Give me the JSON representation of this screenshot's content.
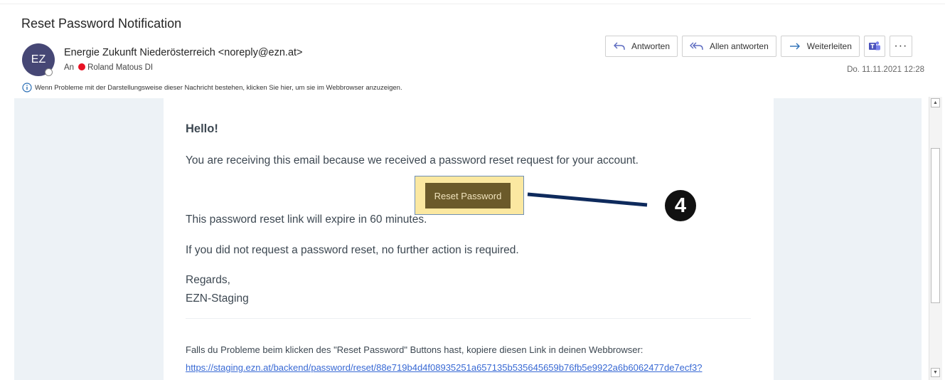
{
  "header": {
    "subject": "Reset Password Notification",
    "avatar_initials": "EZ",
    "from": "Energie Zukunft Niederösterreich <noreply@ezn.at>",
    "to_label": "An",
    "to_name": "Roland Matous DI",
    "date": "Do. 11.11.2021 12:28",
    "info_text": "Wenn Probleme mit der Darstellungsweise dieser Nachricht bestehen, klicken Sie hier, um sie im Webbrowser anzuzeigen."
  },
  "toolbar": {
    "reply": "Antworten",
    "reply_all": "Allen antworten",
    "forward": "Weiterleiten",
    "more": "···",
    "icons": [
      "reply-icon",
      "reply-all-icon",
      "forward-icon",
      "teams-icon",
      "more-icon"
    ]
  },
  "message": {
    "greeting": "Hello!",
    "line1": "You are receiving this email because we received a password reset request for your account.",
    "button": "Reset Password",
    "line2": "This password reset link will expire in 60 minutes.",
    "line3": "If you did not request a password reset, no further action is required.",
    "regards": "Regards,",
    "signature": "EZN-Staging",
    "subcopy": "Falls du Probleme beim klicken des \"Reset Password\" Buttons hast, kopiere diesen Link in deinen Webbrowser:",
    "link": "https://staging.ezn.at/backend/password/reset/88e719b4d4f08935251a657135b535645659b76fb5e9922a6b6062477de7ecf3?"
  },
  "annotation": {
    "badge": "4"
  },
  "colors": {
    "avatar": "#464775",
    "presence_busy": "#e81123",
    "button_bg": "#6b5a2a",
    "highlight": "#fbe8a1",
    "callout_line": "#0e2a5c",
    "link": "#3869d4",
    "message_bg": "#edf2f6"
  }
}
